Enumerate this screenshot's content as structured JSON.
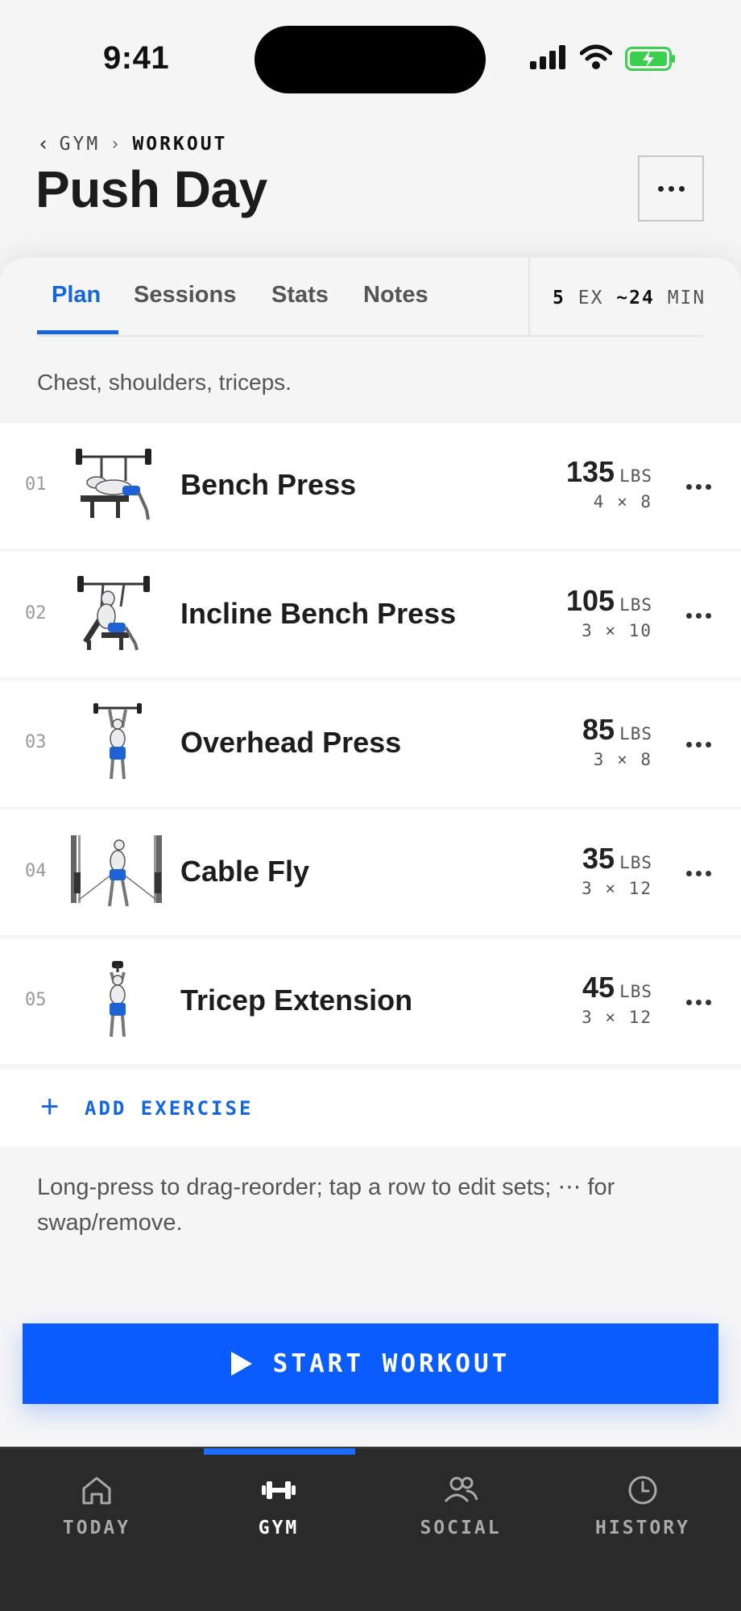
{
  "status_bar": {
    "time": "9:41"
  },
  "header": {
    "breadcrumb": {
      "back_glyph": "‹",
      "parent": "GYM",
      "separator": "›",
      "current": "WORKOUT"
    },
    "title": "Push Day",
    "more_icon": "more-horizontal-icon"
  },
  "tabs": [
    {
      "label": "Plan",
      "active": true
    },
    {
      "label": "Sessions",
      "active": false
    },
    {
      "label": "Stats",
      "active": false
    },
    {
      "label": "Notes",
      "active": false
    }
  ],
  "summary": {
    "exercise_count": "5",
    "exercise_unit": "EX",
    "duration": "~24",
    "duration_unit": "MIN"
  },
  "description": "Chest, shoulders, triceps.",
  "exercises": [
    {
      "index": "01",
      "name": "Bench Press",
      "weight": "135",
      "unit": "LBS",
      "sets": "4 × 8"
    },
    {
      "index": "02",
      "name": "Incline Bench Press",
      "weight": "105",
      "unit": "LBS",
      "sets": "3 × 10"
    },
    {
      "index": "03",
      "name": "Overhead Press",
      "weight": "85",
      "unit": "LBS",
      "sets": "3 × 8"
    },
    {
      "index": "04",
      "name": "Cable Fly",
      "weight": "35",
      "unit": "LBS",
      "sets": "3 × 12"
    },
    {
      "index": "05",
      "name": "Tricep Extension",
      "weight": "45",
      "unit": "LBS",
      "sets": "3 × 12"
    }
  ],
  "add_exercise": {
    "icon": "+",
    "label": "ADD EXERCISE"
  },
  "hint": "Long-press to drag-reorder; tap a row to edit sets; ⋯ for swap/remove.",
  "start_button": {
    "label": "START WORKOUT"
  },
  "nav": [
    {
      "label": "TODAY",
      "icon": "home-icon",
      "active": false
    },
    {
      "label": "GYM",
      "icon": "dumbbell-icon",
      "active": true
    },
    {
      "label": "SOCIAL",
      "icon": "people-icon",
      "active": false
    },
    {
      "label": "HISTORY",
      "icon": "clock-icon",
      "active": false
    }
  ],
  "colors": {
    "accent": "#1565e0",
    "start_button": "#0b5cff",
    "nav_bg": "#2a2a2a",
    "figure_shorts": "#1e63d6"
  }
}
